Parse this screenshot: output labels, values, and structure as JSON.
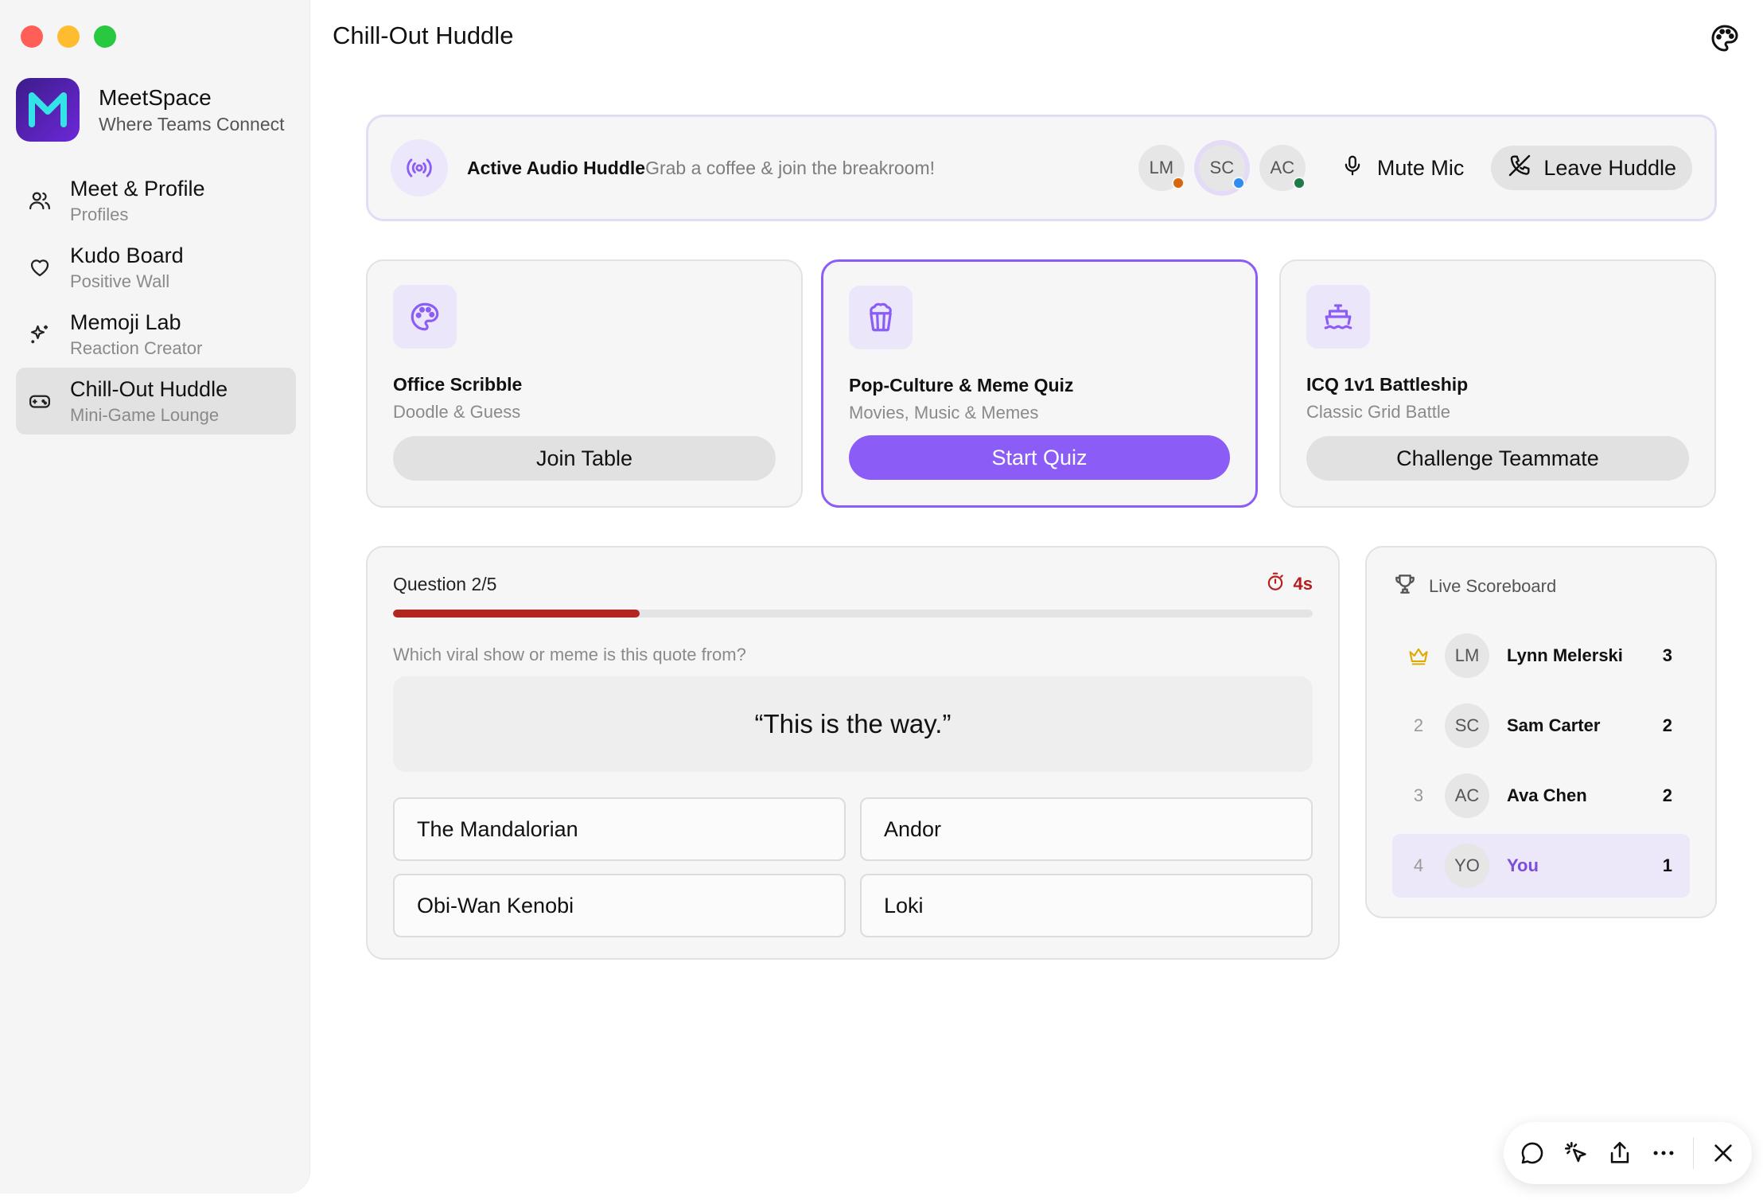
{
  "app": {
    "name": "MeetSpace",
    "tagline": "Where Teams Connect",
    "logo_letter": "M"
  },
  "sidebar": {
    "items": [
      {
        "label": "Meet & Profile",
        "sub": "Profiles",
        "icon": "users-icon"
      },
      {
        "label": "Kudo Board",
        "sub": "Positive Wall",
        "icon": "heart-icon"
      },
      {
        "label": "Memoji Lab",
        "sub": "Reaction Creator",
        "icon": "sparkles-icon"
      },
      {
        "label": "Chill-Out Huddle",
        "sub": "Mini-Game Lounge",
        "icon": "gamepad-icon",
        "active": true
      }
    ]
  },
  "header": {
    "title": "Chill-Out Huddle"
  },
  "huddle": {
    "title": "Active Audio Huddle",
    "subtitle": "Grab a coffee & join the breakroom!",
    "participants": [
      {
        "initials": "LM",
        "status_color": "#d9650f"
      },
      {
        "initials": "SC",
        "status_color": "#2f8cf0",
        "speaking": true
      },
      {
        "initials": "AC",
        "status_color": "#1e7a4a"
      }
    ],
    "mute_label": "Mute Mic",
    "leave_label": "Leave Huddle"
  },
  "games": [
    {
      "title": "Office Scribble",
      "sub": "Doodle & Guess",
      "button": "Join Table",
      "icon": "palette-icon"
    },
    {
      "title": "Pop-Culture & Meme Quiz",
      "sub": "Movies, Music & Memes",
      "button": "Start Quiz",
      "icon": "popcorn-icon",
      "selected": true
    },
    {
      "title": "ICQ 1v1 Battleship",
      "sub": "Classic Grid Battle",
      "button": "Challenge Teammate",
      "icon": "ship-icon"
    }
  ],
  "quiz": {
    "question_label": "Question 2/5",
    "timer": "4s",
    "progress_fraction": 0.268,
    "prompt": "Which viral show or meme is this quote from?",
    "quote": "“This is the way.”",
    "answers": [
      "The Mandalorian",
      "Andor",
      "Obi-Wan Kenobi",
      "Loki"
    ]
  },
  "scoreboard": {
    "title": "Live Scoreboard",
    "rows": [
      {
        "rank": "",
        "initials": "LM",
        "name": "Lynn Melerski",
        "points": "3",
        "leader": true
      },
      {
        "rank": "2",
        "initials": "SC",
        "name": "Sam Carter",
        "points": "2"
      },
      {
        "rank": "3",
        "initials": "AC",
        "name": "Ava Chen",
        "points": "2"
      },
      {
        "rank": "4",
        "initials": "YO",
        "name": "You",
        "points": "1",
        "me": true
      }
    ]
  },
  "colors": {
    "accent": "#8b5cf6",
    "timer": "#b91c1c"
  }
}
